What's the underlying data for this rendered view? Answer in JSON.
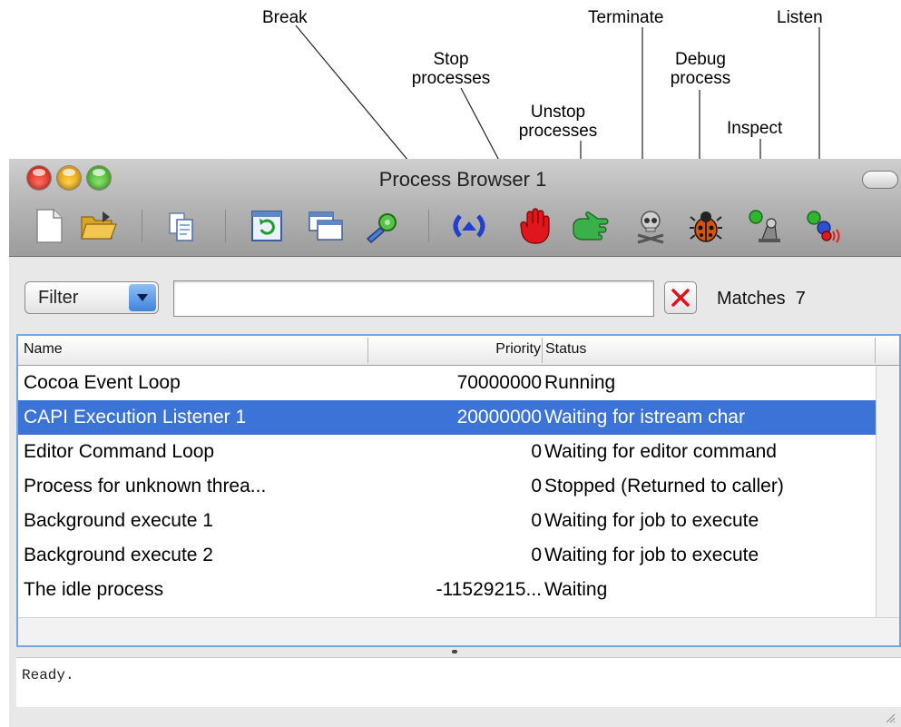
{
  "callouts": {
    "break": "Break",
    "stop": [
      "Stop",
      "processes"
    ],
    "unstop": [
      "Unstop",
      "processes"
    ],
    "terminate": "Terminate",
    "debug": [
      "Debug",
      "process"
    ],
    "inspect": "Inspect",
    "listen": "Listen"
  },
  "window": {
    "title": "Process Browser 1"
  },
  "toolbar": {
    "icons": [
      "new-document-icon",
      "open-folder-icon",
      "copy-icon",
      "refresh-icon",
      "windows-icon",
      "tools-icon",
      "break-icon",
      "stop-hand-icon",
      "unstop-hand-icon",
      "terminate-skull-icon",
      "debug-bug-icon",
      "inspect-icon",
      "listen-icon"
    ]
  },
  "filter": {
    "label": "Filter",
    "value": "",
    "matches_label": "Matches",
    "matches_count": "7"
  },
  "table": {
    "headers": {
      "name": "Name",
      "priority": "Priority",
      "status": "Status"
    },
    "rows": [
      {
        "name": "Cocoa Event Loop",
        "priority": "70000000",
        "status": "Running"
      },
      {
        "name": "CAPI Execution Listener 1",
        "priority": "20000000",
        "status": "Waiting for istream char"
      },
      {
        "name": "Editor Command Loop",
        "priority": "0",
        "status": "Waiting for editor command"
      },
      {
        "name": "Process for unknown threa...",
        "priority": "0",
        "status": "Stopped (Returned to caller)"
      },
      {
        "name": "Background execute 1",
        "priority": "0",
        "status": "Waiting for job to execute"
      },
      {
        "name": "Background execute 2",
        "priority": "0",
        "status": "Waiting for job to execute"
      },
      {
        "name": "The idle process",
        "priority": "-11529215...",
        "status": "Waiting"
      }
    ],
    "selected_index": 1
  },
  "status": {
    "text": "Ready."
  },
  "colors": {
    "selection": "#3b74d6",
    "table_border": "#7aa4e0"
  }
}
